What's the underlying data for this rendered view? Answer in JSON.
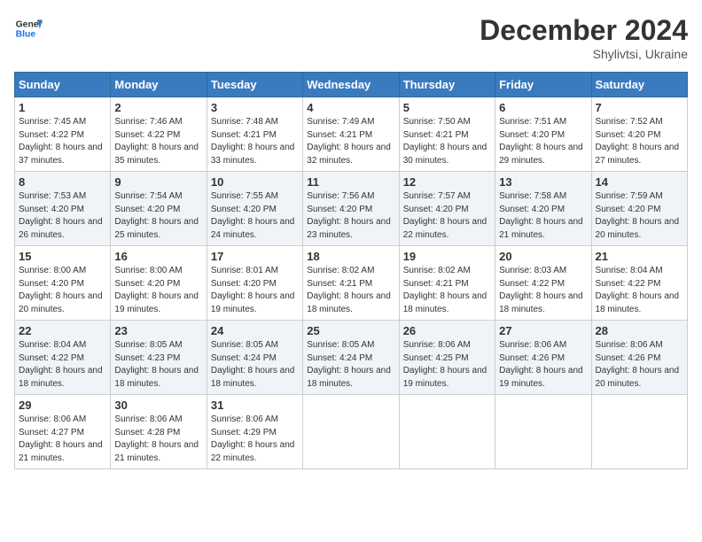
{
  "logo": {
    "line1": "General",
    "line2": "Blue"
  },
  "header": {
    "month_year": "December 2024",
    "location": "Shylivtsi, Ukraine"
  },
  "weekdays": [
    "Sunday",
    "Monday",
    "Tuesday",
    "Wednesday",
    "Thursday",
    "Friday",
    "Saturday"
  ],
  "weeks": [
    [
      {
        "day": "1",
        "sunrise": "7:45 AM",
        "sunset": "4:22 PM",
        "daylight": "8 hours and 37 minutes."
      },
      {
        "day": "2",
        "sunrise": "7:46 AM",
        "sunset": "4:22 PM",
        "daylight": "8 hours and 35 minutes."
      },
      {
        "day": "3",
        "sunrise": "7:48 AM",
        "sunset": "4:21 PM",
        "daylight": "8 hours and 33 minutes."
      },
      {
        "day": "4",
        "sunrise": "7:49 AM",
        "sunset": "4:21 PM",
        "daylight": "8 hours and 32 minutes."
      },
      {
        "day": "5",
        "sunrise": "7:50 AM",
        "sunset": "4:21 PM",
        "daylight": "8 hours and 30 minutes."
      },
      {
        "day": "6",
        "sunrise": "7:51 AM",
        "sunset": "4:20 PM",
        "daylight": "8 hours and 29 minutes."
      },
      {
        "day": "7",
        "sunrise": "7:52 AM",
        "sunset": "4:20 PM",
        "daylight": "8 hours and 27 minutes."
      }
    ],
    [
      {
        "day": "8",
        "sunrise": "7:53 AM",
        "sunset": "4:20 PM",
        "daylight": "8 hours and 26 minutes."
      },
      {
        "day": "9",
        "sunrise": "7:54 AM",
        "sunset": "4:20 PM",
        "daylight": "8 hours and 25 minutes."
      },
      {
        "day": "10",
        "sunrise": "7:55 AM",
        "sunset": "4:20 PM",
        "daylight": "8 hours and 24 minutes."
      },
      {
        "day": "11",
        "sunrise": "7:56 AM",
        "sunset": "4:20 PM",
        "daylight": "8 hours and 23 minutes."
      },
      {
        "day": "12",
        "sunrise": "7:57 AM",
        "sunset": "4:20 PM",
        "daylight": "8 hours and 22 minutes."
      },
      {
        "day": "13",
        "sunrise": "7:58 AM",
        "sunset": "4:20 PM",
        "daylight": "8 hours and 21 minutes."
      },
      {
        "day": "14",
        "sunrise": "7:59 AM",
        "sunset": "4:20 PM",
        "daylight": "8 hours and 20 minutes."
      }
    ],
    [
      {
        "day": "15",
        "sunrise": "8:00 AM",
        "sunset": "4:20 PM",
        "daylight": "8 hours and 20 minutes."
      },
      {
        "day": "16",
        "sunrise": "8:00 AM",
        "sunset": "4:20 PM",
        "daylight": "8 hours and 19 minutes."
      },
      {
        "day": "17",
        "sunrise": "8:01 AM",
        "sunset": "4:20 PM",
        "daylight": "8 hours and 19 minutes."
      },
      {
        "day": "18",
        "sunrise": "8:02 AM",
        "sunset": "4:21 PM",
        "daylight": "8 hours and 18 minutes."
      },
      {
        "day": "19",
        "sunrise": "8:02 AM",
        "sunset": "4:21 PM",
        "daylight": "8 hours and 18 minutes."
      },
      {
        "day": "20",
        "sunrise": "8:03 AM",
        "sunset": "4:22 PM",
        "daylight": "8 hours and 18 minutes."
      },
      {
        "day": "21",
        "sunrise": "8:04 AM",
        "sunset": "4:22 PM",
        "daylight": "8 hours and 18 minutes."
      }
    ],
    [
      {
        "day": "22",
        "sunrise": "8:04 AM",
        "sunset": "4:22 PM",
        "daylight": "8 hours and 18 minutes."
      },
      {
        "day": "23",
        "sunrise": "8:05 AM",
        "sunset": "4:23 PM",
        "daylight": "8 hours and 18 minutes."
      },
      {
        "day": "24",
        "sunrise": "8:05 AM",
        "sunset": "4:24 PM",
        "daylight": "8 hours and 18 minutes."
      },
      {
        "day": "25",
        "sunrise": "8:05 AM",
        "sunset": "4:24 PM",
        "daylight": "8 hours and 18 minutes."
      },
      {
        "day": "26",
        "sunrise": "8:06 AM",
        "sunset": "4:25 PM",
        "daylight": "8 hours and 19 minutes."
      },
      {
        "day": "27",
        "sunrise": "8:06 AM",
        "sunset": "4:26 PM",
        "daylight": "8 hours and 19 minutes."
      },
      {
        "day": "28",
        "sunrise": "8:06 AM",
        "sunset": "4:26 PM",
        "daylight": "8 hours and 20 minutes."
      }
    ],
    [
      {
        "day": "29",
        "sunrise": "8:06 AM",
        "sunset": "4:27 PM",
        "daylight": "8 hours and 21 minutes."
      },
      {
        "day": "30",
        "sunrise": "8:06 AM",
        "sunset": "4:28 PM",
        "daylight": "8 hours and 21 minutes."
      },
      {
        "day": "31",
        "sunrise": "8:06 AM",
        "sunset": "4:29 PM",
        "daylight": "8 hours and 22 minutes."
      },
      null,
      null,
      null,
      null
    ]
  ]
}
